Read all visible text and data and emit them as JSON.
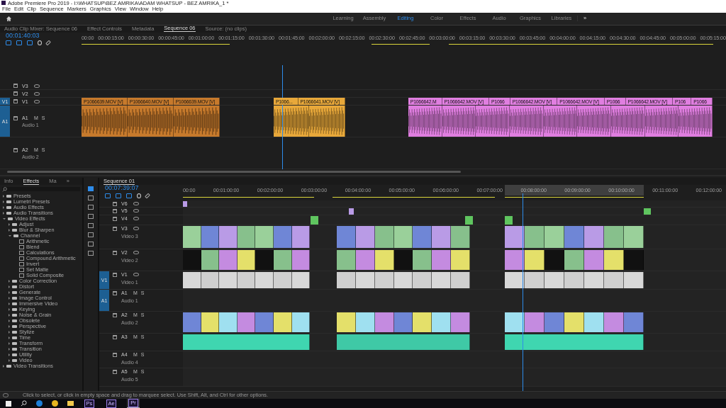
{
  "window": {
    "title": "Adobe Premiere Pro 2019 - I:\\WHATSUP\\BEZ AMRIKA\\ADAM WHATSUP - BEZ AMRIKA_1 *"
  },
  "menu": [
    "File",
    "Edit",
    "Clip",
    "Sequence",
    "Markers",
    "Graphics",
    "View",
    "Window",
    "Help"
  ],
  "workspaces": [
    {
      "label": "Learning",
      "selected": false
    },
    {
      "label": "Assembly",
      "selected": false
    },
    {
      "label": "Editing",
      "selected": true
    },
    {
      "label": "Color",
      "selected": false
    },
    {
      "label": "Effects",
      "selected": false
    },
    {
      "label": "Audio",
      "selected": false
    },
    {
      "label": "Graphics",
      "selected": false
    },
    {
      "label": "Libraries",
      "selected": false
    }
  ],
  "workspace_more": "»",
  "top_panel": {
    "tabs": [
      {
        "label": "Audio Clip Mixer: Sequence 06",
        "selected": false
      },
      {
        "label": "Effect Controls",
        "selected": false
      },
      {
        "label": "Metadata",
        "selected": false
      },
      {
        "label": "Sequence 06",
        "selected": true
      },
      {
        "label": "Source: (no clips)",
        "selected": false
      }
    ],
    "timecode": "00:01:40:03",
    "ruler": [
      "00:00",
      "00:00:15:00",
      "00:00:30:00",
      "00:00:45:00",
      "00:01:00:00",
      "00:01:15:00",
      "00:01:30:00",
      "00:01:45:00",
      "00:02:00:00",
      "00:02:15:00",
      "00:02:30:00",
      "00:02:45:00",
      "00:03:00:00",
      "00:03:15:00",
      "00:03:30:00",
      "00:03:45:00",
      "00:04:00:00",
      "00:04:15:00",
      "00:04:30:00",
      "00:04:45:00",
      "00:05:00:00",
      "00:05:15:00"
    ],
    "tracks": [
      {
        "kind": "video",
        "label": "V3"
      },
      {
        "kind": "video",
        "label": "V2"
      },
      {
        "kind": "video",
        "label": "V1",
        "patch": "V1"
      },
      {
        "kind": "audio",
        "label": "A1",
        "name": "Audio 1",
        "patch": "A1",
        "buttons": [
          "M",
          "S"
        ]
      },
      {
        "kind": "audio",
        "label": "A2",
        "name": "Audio 2",
        "buttons": [
          "M",
          "S"
        ]
      }
    ],
    "clip_groups": [
      {
        "color": "#c77a2c",
        "clips": [
          "P1066639.MOV [V]",
          "P1066640.MOV [V]",
          "P1066639.MOV [V]"
        ]
      },
      {
        "color": "#e8a83a",
        "clips": [
          "P1066...",
          "P1066641.MOV [V]"
        ]
      },
      {
        "color": "#e07ee0",
        "clips": [
          "P1066642.M",
          "P1066642.MOV [V]",
          "P1066",
          "P1066642.MOV [V]",
          "P1066642.MOV [V]",
          "P1066",
          "P1066642.MOV [V]",
          "P106",
          "P1066"
        ]
      }
    ]
  },
  "effects_panel": {
    "tabs": [
      {
        "label": "Info",
        "selected": false
      },
      {
        "label": "Effects",
        "selected": true
      },
      {
        "label": "Ma",
        "selected": false
      }
    ],
    "more": "»",
    "tree": [
      {
        "kind": "folder",
        "label": "Presets",
        "expanded": false
      },
      {
        "kind": "folder",
        "label": "Lumetri Presets",
        "expanded": false
      },
      {
        "kind": "folder",
        "label": "Audio Effects",
        "expanded": false
      },
      {
        "kind": "folder",
        "label": "Audio Transitions",
        "expanded": false
      },
      {
        "kind": "folder",
        "label": "Video Effects",
        "expanded": true,
        "children": [
          {
            "kind": "folder",
            "label": "Adjust",
            "expanded": false
          },
          {
            "kind": "folder",
            "label": "Blur & Sharpen",
            "expanded": false
          },
          {
            "kind": "folder",
            "label": "Channel",
            "expanded": true,
            "children": [
              {
                "kind": "effect",
                "label": "Arithmetic"
              },
              {
                "kind": "effect",
                "label": "Blend"
              },
              {
                "kind": "effect",
                "label": "Calculations"
              },
              {
                "kind": "effect",
                "label": "Compound Arithmetic"
              },
              {
                "kind": "effect",
                "label": "Invert"
              },
              {
                "kind": "effect",
                "label": "Set Matte"
              },
              {
                "kind": "effect",
                "label": "Solid Composite"
              }
            ]
          },
          {
            "kind": "folder",
            "label": "Color Correction",
            "expanded": false
          },
          {
            "kind": "folder",
            "label": "Distort",
            "expanded": false
          },
          {
            "kind": "folder",
            "label": "Generate",
            "expanded": false
          },
          {
            "kind": "folder",
            "label": "Image Control",
            "expanded": false
          },
          {
            "kind": "folder",
            "label": "Immersive Video",
            "expanded": false
          },
          {
            "kind": "folder",
            "label": "Keying",
            "expanded": false
          },
          {
            "kind": "folder",
            "label": "Noise & Grain",
            "expanded": false
          },
          {
            "kind": "folder",
            "label": "Obsolete",
            "expanded": false
          },
          {
            "kind": "folder",
            "label": "Perspective",
            "expanded": false
          },
          {
            "kind": "folder",
            "label": "Stylize",
            "expanded": false
          },
          {
            "kind": "folder",
            "label": "Time",
            "expanded": false
          },
          {
            "kind": "folder",
            "label": "Transform",
            "expanded": false
          },
          {
            "kind": "folder",
            "label": "Transition",
            "expanded": false
          },
          {
            "kind": "folder",
            "label": "Utility",
            "expanded": false
          },
          {
            "kind": "folder",
            "label": "Video",
            "expanded": false
          }
        ]
      },
      {
        "kind": "folder",
        "label": "Video Transitions",
        "expanded": false
      }
    ]
  },
  "timeline": {
    "tab": "Sequence 01",
    "timecode": "00:07:39:07",
    "ruler": [
      "00:00",
      "00:01:00:00",
      "00:02:00:00",
      "00:03:00:00",
      "00:04:00:00",
      "00:05:00:00",
      "00:06:00:00",
      "00:07:00:00",
      "00:08:00:00",
      "00:09:00:00",
      "00:10:00:00",
      "00:11:00:00",
      "00:12:00:00"
    ],
    "tracks": [
      {
        "kind": "video",
        "label": "V6"
      },
      {
        "kind": "video",
        "label": "V5"
      },
      {
        "kind": "video",
        "label": "V4"
      },
      {
        "kind": "video",
        "label": "V3",
        "name": "Video 3"
      },
      {
        "kind": "video",
        "label": "V2",
        "name": "Video 2"
      },
      {
        "kind": "video",
        "label": "V1",
        "name": "Video 1",
        "patch": "V1"
      },
      {
        "kind": "audio",
        "label": "A1",
        "name": "Audio 1",
        "patch": "A1",
        "buttons": [
          "M",
          "S"
        ]
      },
      {
        "kind": "audio",
        "label": "A2",
        "name": "Audio 2",
        "buttons": [
          "M",
          "S"
        ]
      },
      {
        "kind": "audio",
        "label": "A3",
        "buttons": [
          "M",
          "S"
        ]
      },
      {
        "kind": "audio",
        "label": "A4",
        "name": "Audio 4",
        "buttons": [
          "M",
          "S"
        ]
      },
      {
        "kind": "audio",
        "label": "A5",
        "name": "Audio 5",
        "buttons": [
          "M",
          "S"
        ]
      }
    ]
  },
  "status_bar": "Click to select, or click in empty space and drag to marquee select. Use Shift, Alt, and Ctrl for other options.",
  "taskbar": [
    {
      "label": "Ps",
      "selected": false
    },
    {
      "label": "Ae",
      "selected": false
    },
    {
      "label": "Pr",
      "selected": true
    }
  ]
}
